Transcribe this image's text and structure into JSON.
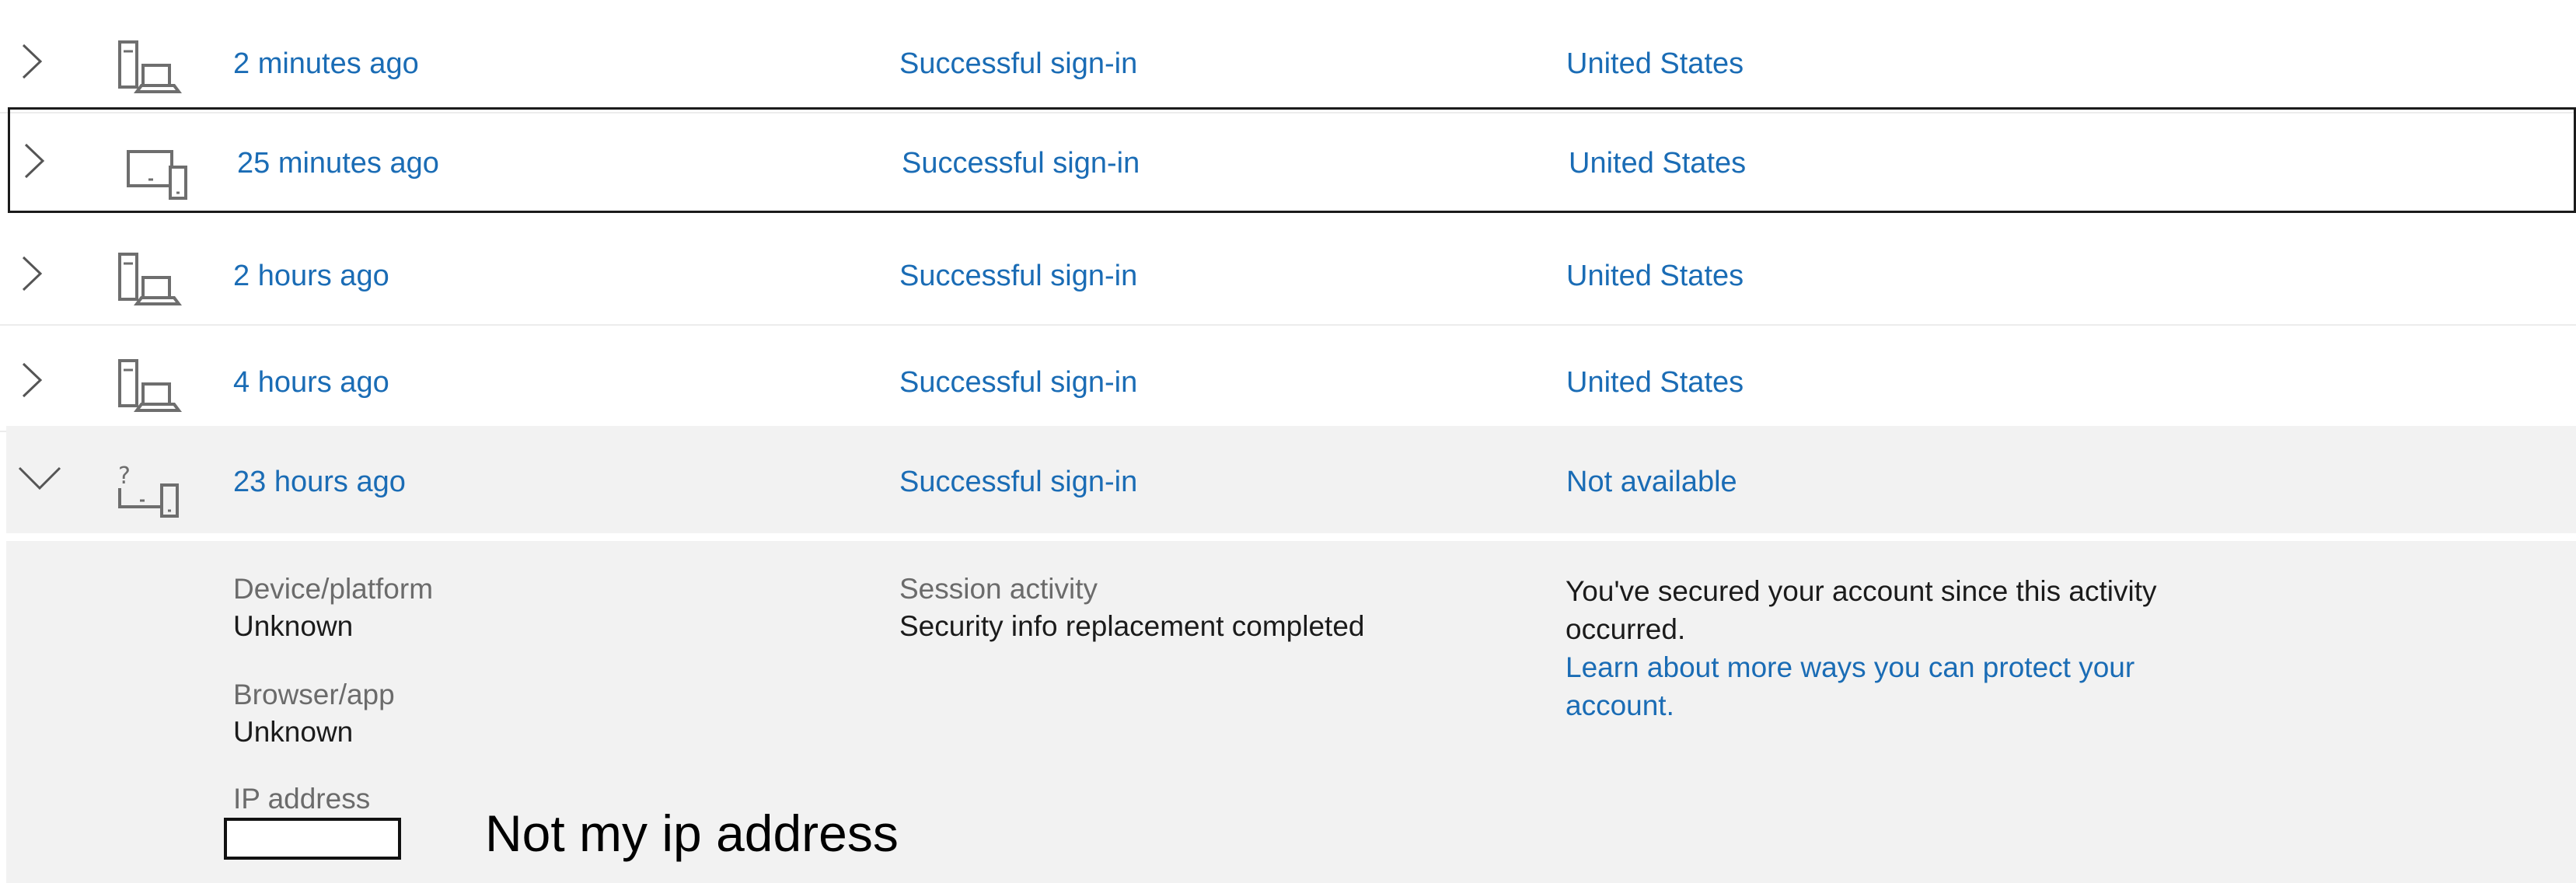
{
  "activity": {
    "rows": [
      {
        "time": "2 minutes ago",
        "status": "Successful sign-in",
        "location": "United States",
        "device_icon": "desktop-laptop-icon"
      },
      {
        "time": "25 minutes ago",
        "status": "Successful sign-in",
        "location": "United States",
        "device_icon": "tablet-phone-icon"
      },
      {
        "time": "2 hours ago",
        "status": "Successful sign-in",
        "location": "United States",
        "device_icon": "desktop-laptop-icon"
      },
      {
        "time": "4 hours ago",
        "status": "Successful sign-in",
        "location": "United States",
        "device_icon": "desktop-laptop-icon"
      },
      {
        "time": "23 hours ago",
        "status": "Successful sign-in",
        "location": "Not available",
        "device_icon": "unknown-device-icon"
      }
    ],
    "details": {
      "device_label": "Device/platform",
      "device_value": "Unknown",
      "browser_label": "Browser/app",
      "browser_value": "Unknown",
      "ip_label": "IP address",
      "session_label": "Session activity",
      "session_value": "Security info replacement completed",
      "secured_message": "You've secured your account since this activity occurred.",
      "learn_link": "Learn about more ways you can protect your account."
    },
    "annotation": "Not my ip address"
  },
  "colors": {
    "link": "#1a6cb5",
    "label": "#6b6b6b",
    "text": "#1b1b1b",
    "expanded_bg": "#f2f2f2",
    "icon": "#6e6e6e"
  }
}
